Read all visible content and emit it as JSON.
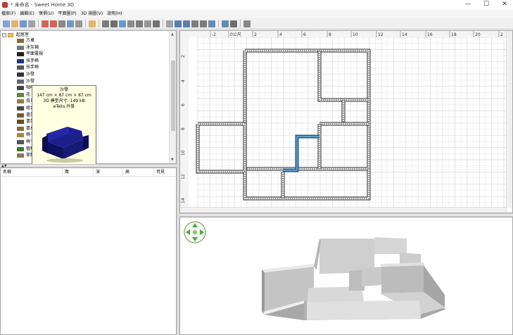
{
  "window": {
    "title": "* 未命名 - Sweet Home 3D",
    "controls": {
      "minimize": "—",
      "maximize": "☐",
      "close": "✕"
    }
  },
  "menubar": {
    "items": [
      "檔案(F)",
      "編輯(E)",
      "傢俱(U)",
      "平面圖(P)",
      "3D 視圖(V)",
      "說明(H)"
    ]
  },
  "toolbar": {
    "buttons": [
      "new-icon",
      "open-icon",
      "save-icon",
      "cut-tool-icon",
      "sep",
      "undo-icon",
      "redo-icon",
      "cut-icon",
      "copy-icon",
      "paste-icon",
      "sep",
      "add-furniture-icon",
      "sep",
      "select-icon",
      "pan-icon",
      "create-walls-icon",
      "create-rooms-icon",
      "create-polylines-icon",
      "create-dimensions-icon",
      "add-text-icon",
      "sep",
      "text-style-bold-icon",
      "text-style-italic-icon",
      "increase-text-icon",
      "decrease-text-icon",
      "zoom-in-icon",
      "zoom-out-icon",
      "sep",
      "create-photo-icon",
      "create-video-icon",
      "sep",
      "help-icon"
    ]
  },
  "catalog": {
    "category": "臥房 (起居室)",
    "category_label": "起居室",
    "items": [
      {
        "label": "方桌",
        "color": "#8b6b3d"
      },
      {
        "label": "冰灰箱",
        "color": "#777777"
      },
      {
        "label": "平面電視",
        "color": "#222222"
      },
      {
        "label": "扶手椅",
        "color": "#22338a"
      },
      {
        "label": "扶手椅",
        "color": "#555566"
      },
      {
        "label": "沙發",
        "color": "#333344"
      },
      {
        "label": "沙發",
        "color": "#666677"
      },
      {
        "label": "咖啡桌",
        "color": "#444444"
      },
      {
        "label": "花",
        "color": "#5a8a3c"
      },
      {
        "label": "長几",
        "color": "#9a7a4a"
      },
      {
        "label": "組合櫃",
        "color": "#4a4a4a"
      },
      {
        "label": "書架",
        "color": "#7a5a2a"
      },
      {
        "label": "書架",
        "color": "#6a4a1a"
      },
      {
        "label": "書桌",
        "color": "#8a6a3a"
      },
      {
        "label": "椅子",
        "color": "#aa8844"
      },
      {
        "label": "椅子",
        "color": "#555555"
      },
      {
        "label": "植物",
        "color": "#3a7a2a"
      },
      {
        "label": "寧靜",
        "color": "#887755"
      }
    ]
  },
  "tooltip": {
    "name": "沙發",
    "dimensions": "147 cm × 87 cm × 87 cm",
    "model_size": "3D 模型尺寸: 149 kB",
    "creator": "eTeks 外掛"
  },
  "furniture_table": {
    "columns": [
      "名稱",
      "寬",
      "深",
      "高",
      "可見"
    ]
  },
  "plan": {
    "ruler_top": [
      "-2",
      "0公尺",
      "2",
      "4",
      "6",
      "8",
      "10",
      "12",
      "14",
      "16",
      "18",
      "20",
      "2"
    ],
    "ruler_left": [
      "2",
      "4",
      "6",
      "8",
      "10",
      "12",
      "14"
    ]
  },
  "colors": {
    "selected_wall": "#1a5d8c",
    "wall": "#222222",
    "grid": "#d8d8d8",
    "accent": "#3d7ec7"
  }
}
